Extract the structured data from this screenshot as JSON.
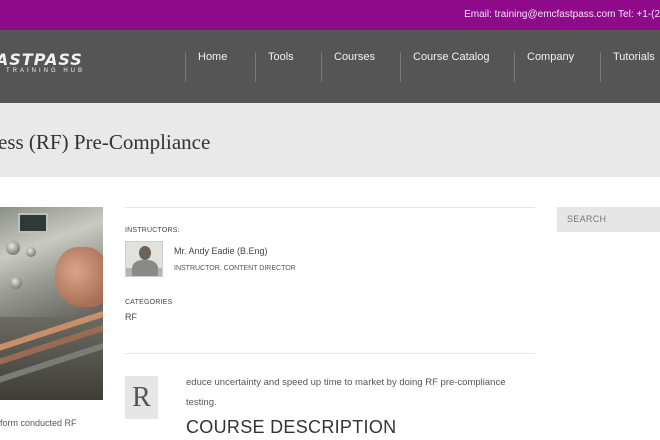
{
  "topbar": {
    "contact": "Email: training@emcfastpass.com Tel: +1-(2"
  },
  "logo": {
    "name": "FASTPASS",
    "tagline": "TRAINING HUB"
  },
  "nav": {
    "items": [
      "Home",
      "Tools",
      "Courses",
      "Course Catalog",
      "Company",
      "Tutorials"
    ]
  },
  "page": {
    "title": "ess (RF) Pre-Compliance"
  },
  "course": {
    "instructors_label": "INSTRUCTORS:",
    "instructor_name": "Mr. Andy Eadie (B.Eng)",
    "instructor_role": "INSTRUCTOR, CONTENT DIRECTOR",
    "categories_label": "CATEGORIES",
    "category": "RF",
    "dropcap": "R",
    "intro": "educe uncertainty and speed up time to market by doing RF pre-compliance testing.",
    "description_heading": "COURSE DESCRIPTION",
    "excerpt": "form conducted RF"
  },
  "sidebar": {
    "search_placeholder": "SEARCH"
  },
  "colors": {
    "topbar": "#8f0a8a",
    "navbar": "#555555",
    "titleband": "#e9e9e9"
  }
}
